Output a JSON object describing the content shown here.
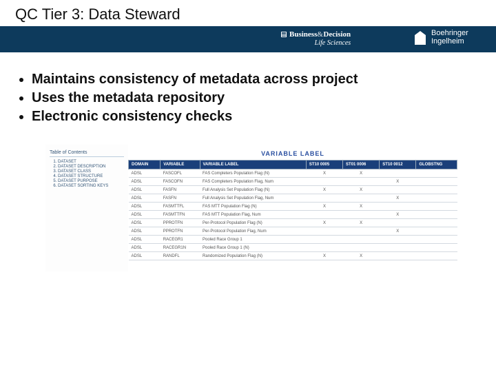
{
  "header": {
    "title": "QC Tier 3: Data Steward",
    "logo1": {
      "brand1": "Business",
      "amp": "&",
      "brand2": "Decision",
      "sub": "Life Sciences"
    },
    "logo2": {
      "line1": "Boehringer",
      "line2": "Ingelheim"
    }
  },
  "bullets": [
    "Maintains consistency of metadata across project",
    "Uses the metadata repository",
    "Electronic consistency checks"
  ],
  "screenshot": {
    "toc_title": "Table of Contents",
    "toc_items": [
      "DATASET",
      "DATASET DESCRIPTION",
      "DATASET CLASS",
      "DATASET STRUCTURE",
      "DATASET PURPOSE",
      "DATASET SORTING KEYS"
    ],
    "table_title": "VARIABLE LABEL",
    "columns": [
      "DOMAIN",
      "VARIABLE",
      "VARIABLE LABEL",
      "ST10 0005",
      "ST01 0006",
      "ST10 0012",
      "GLOBSTNG"
    ],
    "rows": [
      {
        "domain": "ADSL",
        "var": "FASCOFL",
        "label": "FAS Completers Population Flag (N)",
        "c1": "X",
        "c2": "X",
        "c3": "",
        "c4": ""
      },
      {
        "domain": "ADSL",
        "var": "FASCOFN",
        "label": "FAS Completers Population Flag, Num",
        "c1": "",
        "c2": "",
        "c3": "X",
        "c4": ""
      },
      {
        "domain": "ADSL",
        "var": "FASFN",
        "label": "Full Analysis Set Population Flag (N)",
        "c1": "X",
        "c2": "X",
        "c3": "",
        "c4": ""
      },
      {
        "domain": "ADSL",
        "var": "FASFN",
        "label": "Full Analysis Set Population Flag, Num",
        "c1": "",
        "c2": "",
        "c3": "X",
        "c4": ""
      },
      {
        "domain": "ADSL",
        "var": "FASMTTFL",
        "label": "FAS MTT Population Flag (N)",
        "c1": "X",
        "c2": "X",
        "c3": "",
        "c4": ""
      },
      {
        "domain": "ADSL",
        "var": "FASMTTFN",
        "label": "FAS MTT Population Flag, Num",
        "c1": "",
        "c2": "",
        "c3": "X",
        "c4": ""
      },
      {
        "domain": "ADSL",
        "var": "PPROTFN",
        "label": "Per-Protocol Population Flag (N)",
        "c1": "X",
        "c2": "X",
        "c3": "",
        "c4": ""
      },
      {
        "domain": "ADSL",
        "var": "PPROTFN",
        "label": "Per-Protocol Population Flag, Num",
        "c1": "",
        "c2": "",
        "c3": "X",
        "c4": ""
      },
      {
        "domain": "ADSL",
        "var": "RACEGR1",
        "label": "Pooled Race Group 1",
        "c1": "",
        "c2": "",
        "c3": "",
        "c4": ""
      },
      {
        "domain": "ADSL",
        "var": "RACEGR1N",
        "label": "Pooled Race Group 1 (N)",
        "c1": "",
        "c2": "",
        "c3": "",
        "c4": ""
      },
      {
        "domain": "ADSL",
        "var": "RANDFL",
        "label": "Randomized Population Flag (N)",
        "c1": "X",
        "c2": "X",
        "c3": "",
        "c4": ""
      }
    ]
  }
}
